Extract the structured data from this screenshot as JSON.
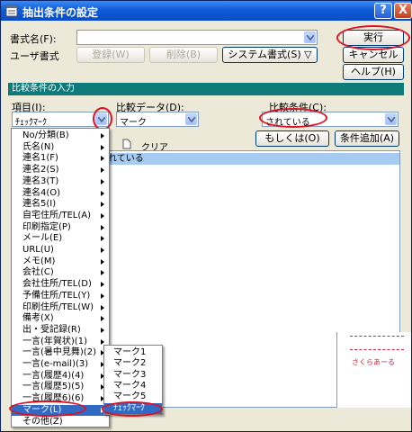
{
  "window": {
    "title": "抽出条件の設定",
    "help_btn": "?",
    "close_btn": "X"
  },
  "format": {
    "name_label": "書式名(F):",
    "name_value": "",
    "user_label": "ユーザ書式",
    "register_btn": "登録(W)",
    "delete_btn": "削除(B)",
    "system_btn": "システム書式(S) ▽"
  },
  "actions": {
    "run": "実行",
    "cancel": "キャンセル",
    "help": "ヘルプ(H)"
  },
  "section_title": "比較条件の入力",
  "fields": {
    "item_label": "項目(I):",
    "item_value": "ﾁｪｯｸﾏｰｸ",
    "data_label": "比較データ(D):",
    "data_value": "マーク",
    "cond_label": "比較条件(C):",
    "cond_value": "されている"
  },
  "buttons": {
    "or": "もしくは(O)",
    "add": "条件追加(A)",
    "clear": "クリア"
  },
  "condition_row": "れている",
  "menu_items": [
    "No/分類(B)",
    "氏名(N)",
    "連名1(F)",
    "連名2(S)",
    "連名3(T)",
    "連名4(O)",
    "連名5(I)",
    "自宅住所/TEL(A)",
    "印刷指定(P)",
    "メール(E)",
    "URL(U)",
    "メモ(M)",
    "会社(C)",
    "会社住所/TEL(D)",
    "予備住所/TEL(Y)",
    "印刷住所/TEL(W)",
    "備考(X)",
    "出・受記録(R)",
    "一言(年賀状)(1)",
    "一言(暑中見舞)(2)",
    "一言(e-mail)(3)",
    "一言(履歴4)(4)",
    "一言(履歴5)(5)",
    "一言(履歴6)(6)",
    "マーク(L)",
    "その他(Z)"
  ],
  "submenu_items": [
    "マーク1",
    "マーク2",
    "マーク3",
    "マーク4",
    "マーク5",
    "ﾁｪｯｸﾏｰｸ"
  ],
  "bg_text": "さくらあーる",
  "colors": {
    "title_blue": "#0a4cc5",
    "section": "#0e7a7a",
    "highlight": "#316ac5",
    "annotation": "#e01020"
  }
}
